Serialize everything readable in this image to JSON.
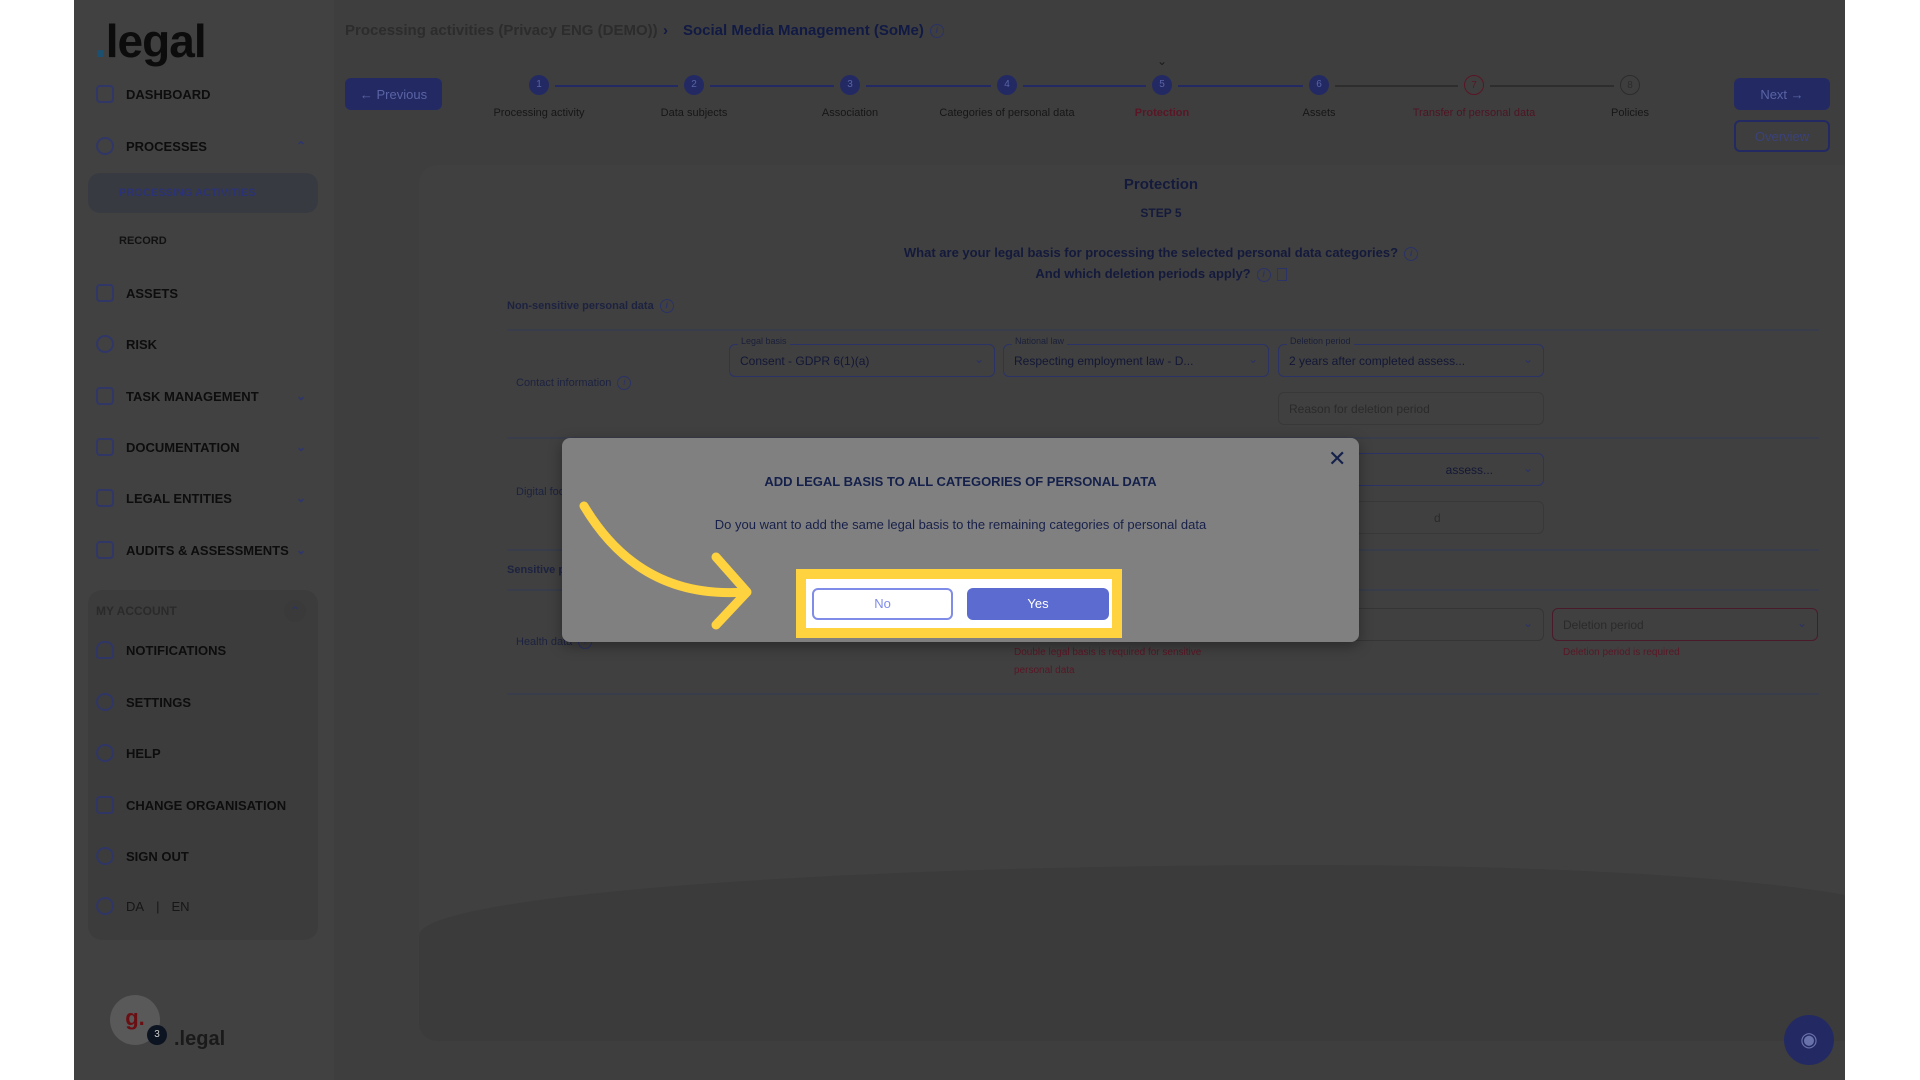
{
  "sidebar": {
    "logo": ".legal",
    "items": [
      {
        "label": "DASHBOARD",
        "icon": "dashboard-icon"
      },
      {
        "label": "PROCESSES",
        "icon": "processes-icon",
        "expanded": true
      },
      {
        "label": "ASSETS",
        "icon": "assets-icon"
      },
      {
        "label": "RISK",
        "icon": "risk-icon"
      },
      {
        "label": "TASK MANAGEMENT",
        "icon": "task-icon"
      },
      {
        "label": "DOCUMENTATION",
        "icon": "documentation-icon"
      },
      {
        "label": "LEGAL ENTITIES",
        "icon": "legal-entities-icon"
      },
      {
        "label": "AUDITS & ASSESSMENTS",
        "icon": "audits-icon"
      }
    ],
    "sub_items": [
      {
        "label": "PROCESSING ACTIVITIES",
        "active": true
      },
      {
        "label": "RECORD"
      }
    ],
    "account": {
      "header": "MY ACCOUNT",
      "items": [
        {
          "label": "NOTIFICATIONS",
          "icon": "bell-icon"
        },
        {
          "label": "SETTINGS",
          "icon": "gear-icon"
        },
        {
          "label": "HELP",
          "icon": "help-icon"
        },
        {
          "label": "CHANGE ORGANISATION",
          "icon": "switch-icon"
        },
        {
          "label": "SIGN OUT",
          "icon": "sign-out-icon"
        }
      ],
      "lang": {
        "da": "DA",
        "sep": "|",
        "en": "EN"
      }
    },
    "avatar": {
      "letter": "g.",
      "badge": "3",
      "brand": ".legal"
    }
  },
  "breadcrumb": {
    "parent": "Processing activities (Privacy ENG (DEMO))",
    "current": "Social Media Management (SoMe)"
  },
  "nav": {
    "previous": "Previous",
    "next": "Next",
    "overview": "Overview"
  },
  "steps": [
    {
      "n": "1",
      "label": "Processing activity",
      "state": "done"
    },
    {
      "n": "2",
      "label": "Data subjects",
      "state": "done"
    },
    {
      "n": "3",
      "label": "Association",
      "state": "done"
    },
    {
      "n": "4",
      "label": "Categories of personal data",
      "state": "done"
    },
    {
      "n": "5",
      "label": "Protection",
      "state": "current"
    },
    {
      "n": "6",
      "label": "Assets",
      "state": "done"
    },
    {
      "n": "7",
      "label": "Transfer of personal data",
      "state": "error"
    },
    {
      "n": "8",
      "label": "Policies",
      "state": "todo"
    }
  ],
  "content": {
    "title": "Protection",
    "step": "STEP 5",
    "question1": "What are your legal basis for processing the selected personal data categories?",
    "question2": "And which deletion periods apply?",
    "non_sensitive": "Non-sensitive personal data",
    "sensitive": "Sensitive personal data",
    "rows": {
      "contact": {
        "label": "Contact information",
        "legal_basis_label": "Legal basis",
        "legal_basis": "Consent - GDPR 6(1)(a)",
        "national_law_label": "National law",
        "national_law": "Respecting employment law - D...",
        "deletion_label": "Deletion period",
        "deletion": "2 years after completed assess...",
        "reason_placeholder": "Reason for deletion period"
      },
      "digital": {
        "label": "Digital footprints",
        "deletion_partial": "assess...",
        "reason_partial": "d"
      },
      "health": {
        "label": "Health data",
        "deletion_placeholder": "Deletion period",
        "error_legal": "Double legal basis is required for sensitive personal data",
        "error_deletion": "Deletion period is required"
      }
    }
  },
  "modal": {
    "title": "ADD LEGAL BASIS TO ALL CATEGORIES OF PERSONAL DATA",
    "body": "Do you want to add the same legal basis to the remaining categories of personal data",
    "no": "No",
    "yes": "Yes"
  },
  "colors": {
    "highlight": "#ffd23f",
    "primary": "#5c6bd0",
    "error": "#c0304e"
  }
}
